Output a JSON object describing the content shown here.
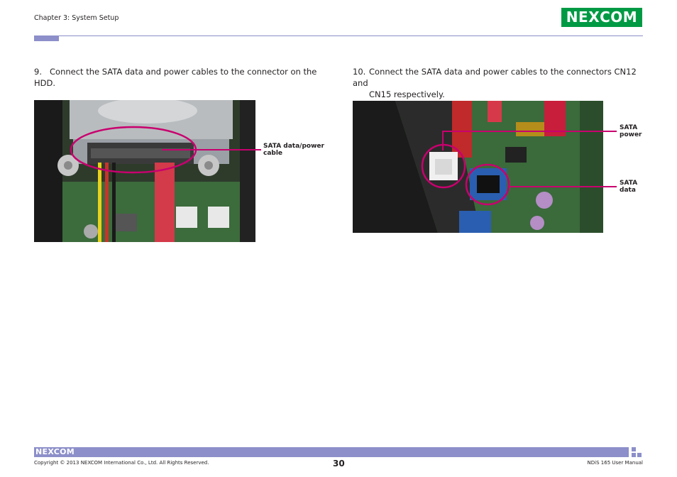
{
  "header": {
    "chapter": "Chapter 3: System Setup",
    "logo_text_left": "NE",
    "logo_text_x": "X",
    "logo_text_right": "COM",
    "accent_color": "#8c8fc9",
    "logo_color": "#009a44"
  },
  "steps": [
    {
      "number": "9.",
      "text": "Connect the SATA data and power cables to the connector on the HDD."
    },
    {
      "number": "10.",
      "text_line1": "Connect the SATA data and power cables to the connectors CN12 and",
      "text_line2": "CN15 respectively."
    }
  ],
  "callouts": {
    "photo1": {
      "line1": "SATA data/power",
      "line2": "cable"
    },
    "photo2_power": {
      "line1": "SATA",
      "line2": "power"
    },
    "photo2_data": {
      "line1": "SATA",
      "line2": "data"
    },
    "highlight_color": "#c8006e"
  },
  "footer": {
    "logo": "NEXCOM",
    "copyright": "Copyright © 2013 NEXCOM International Co., Ltd. All Rights Reserved.",
    "page_number": "30",
    "manual": "NDiS 165 User Manual"
  }
}
